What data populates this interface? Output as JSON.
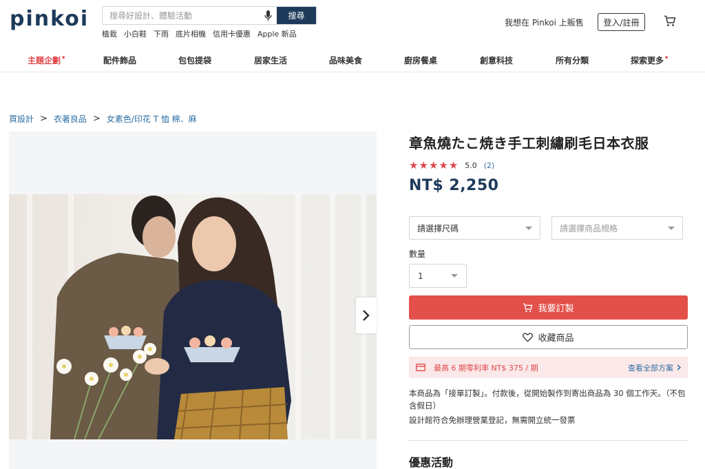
{
  "header": {
    "logo": "pinkoi",
    "search_placeholder": "搜尋好設計、體驗活動",
    "search_button": "搜尋",
    "quick_links": [
      "植栽",
      "小白鞋",
      "下雨",
      "底片相機",
      "信用卡優惠",
      "Apple 新品"
    ],
    "sell_link": "我想在 Pinkoi 上販售",
    "login_button": "登入/註冊"
  },
  "nav": {
    "items": [
      "主題企劃",
      "配件飾品",
      "包包提袋",
      "居家生活",
      "品味美食",
      "廚房餐桌",
      "創意科技",
      "所有分類",
      "探索更多"
    ],
    "dot": "•"
  },
  "breadcrumb": [
    "買設計",
    "衣著良品",
    "女素色/印花 T 恤 棉．麻"
  ],
  "breadcrumb_sep": ">",
  "product": {
    "title": "章魚燒たこ焼き手工刺繡刷毛日本衣服",
    "rating_stars": 5,
    "rating_score": "5.0",
    "rating_count": "(2)",
    "price": "NT$ 2,250",
    "size_select": "請選擇尺碼",
    "spec_select": "請選擇商品規格",
    "qty_label": "數量",
    "qty_value": "1",
    "buy_button": "我要訂製",
    "fav_button": "收藏商品",
    "installment_text": "最高 6 期零利率 NT$ 375 / 期",
    "installment_more": "查看全部方案",
    "note_made_to_order": "本商品為「接單訂製」。付款後，從開始製作到寄出商品為 30 個工作天。（不包含假日）",
    "note_registration": "設計館符合免辦理營業登記，無需開立統一發票",
    "promo_title": "優惠活動"
  },
  "colors": {
    "brand_navy": "#1e3a5a",
    "accent_red": "#e3504a",
    "link_blue": "#2f6fa3",
    "installment_bg": "#fbe8e8"
  }
}
